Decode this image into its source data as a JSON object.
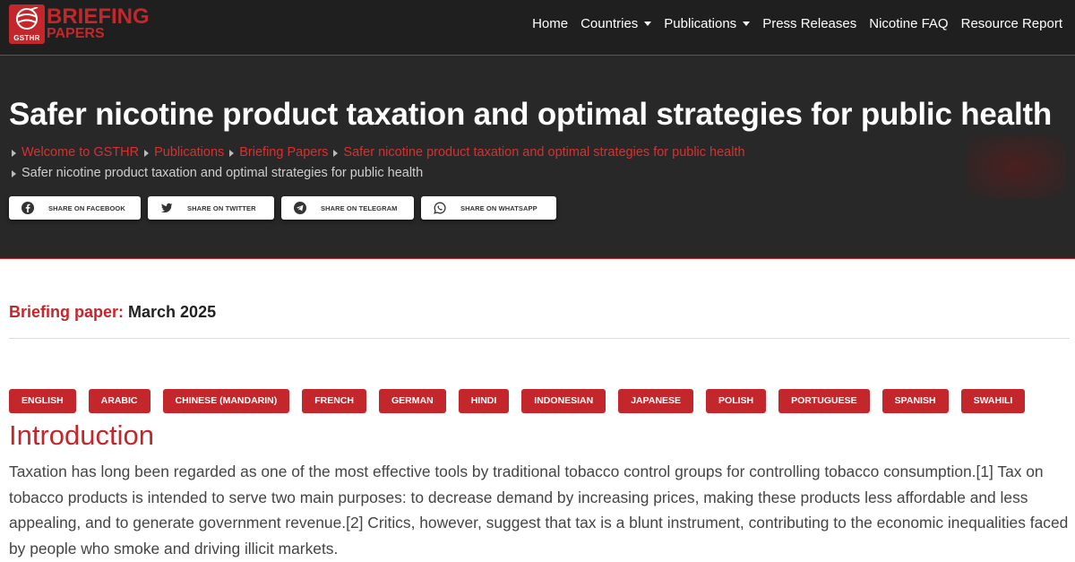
{
  "header": {
    "logo": {
      "badge": "GSTHR",
      "line1": "BRIEFING",
      "line2": "PAPERS"
    },
    "nav": [
      {
        "label": "Home",
        "dropdown": false
      },
      {
        "label": "Countries",
        "dropdown": true
      },
      {
        "label": "Publications",
        "dropdown": true
      },
      {
        "label": "Press Releases",
        "dropdown": false
      },
      {
        "label": "Nicotine FAQ",
        "dropdown": false
      },
      {
        "label": "Resource Report",
        "dropdown": false
      }
    ]
  },
  "hero": {
    "title": "Safer nicotine product taxation and optimal strategies for public health",
    "breadcrumbs": [
      "Welcome to GSTHR",
      "Publications",
      "Briefing Papers",
      "Safer nicotine product taxation and optimal strategies for public health"
    ],
    "breadcrumb_current": "Safer nicotine product taxation and optimal strategies for public health",
    "share": [
      {
        "label": "SHARE ON FACEBOOK",
        "icon": "facebook-icon"
      },
      {
        "label": "SHARE ON TWITTER",
        "icon": "twitter-icon"
      },
      {
        "label": "SHARE ON TELEGRAM",
        "icon": "telegram-icon"
      },
      {
        "label": "SHARE ON WHATSAPP",
        "icon": "whatsapp-icon"
      }
    ]
  },
  "meta": {
    "label": "Briefing paper:",
    "value": "March 2025"
  },
  "languages": [
    "ENGLISH",
    "ARABIC",
    "CHINESE (MANDARIN)",
    "FRENCH",
    "GERMAN",
    "HINDI",
    "INDONESIAN",
    "JAPANESE",
    "POLISH",
    "PORTUGUESE",
    "SPANISH",
    "SWAHILI"
  ],
  "intro": {
    "heading": "Introduction",
    "text": "Taxation has long been regarded as one of the most effective tools by traditional tobacco control groups for controlling tobacco consumption.[1] Tax on tobacco products is intended to serve two main purposes: to decrease demand by increasing prices, making these products less affordable and less appealing, and to generate government revenue.[2] Critics, however, suggest that tax is a blunt instrument, contributing to the economic inequalities faced by people who smoke and driving illicit markets."
  },
  "colors": {
    "accent": "#c3272b",
    "header_bg": "#1f1f1f",
    "hero_bg": "#282828"
  }
}
